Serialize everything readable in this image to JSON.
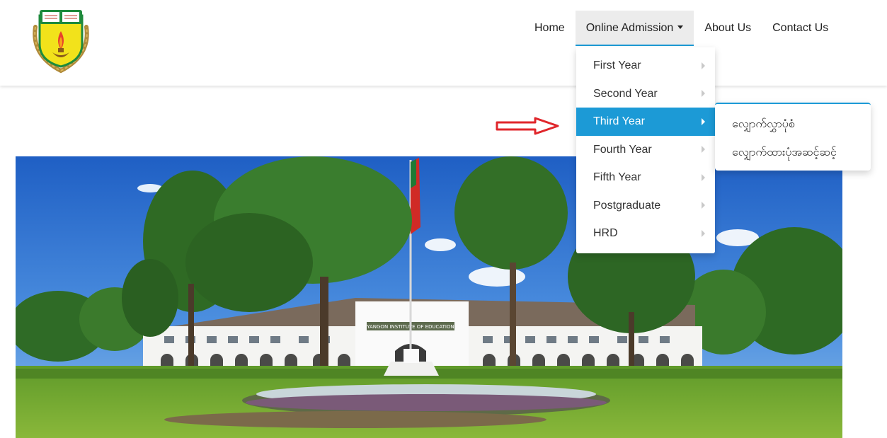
{
  "nav": {
    "home": "Home",
    "online_admission": "Online Admission",
    "about": "About Us",
    "contact": "Contact Us"
  },
  "dropdown": {
    "items": [
      {
        "label": "First Year"
      },
      {
        "label": "Second Year"
      },
      {
        "label": "Third Year",
        "active": true
      },
      {
        "label": "Fourth Year"
      },
      {
        "label": "Fifth Year"
      },
      {
        "label": "Postgraduate"
      },
      {
        "label": "HRD"
      }
    ]
  },
  "submenu": {
    "items": [
      {
        "label": "လျှောက်လွှာပုံစံ"
      },
      {
        "label": "လျှောက်ထားပုံအဆင့်ဆင့်"
      }
    ]
  },
  "photo": {
    "building_sign": "YANGON INSTITUTE OF EDUCATION"
  },
  "colors": {
    "accent": "#1c9ad6",
    "arrow_red": "#e0262b",
    "logo_green": "#1e8a3c",
    "logo_yellow": "#f2e21b"
  }
}
